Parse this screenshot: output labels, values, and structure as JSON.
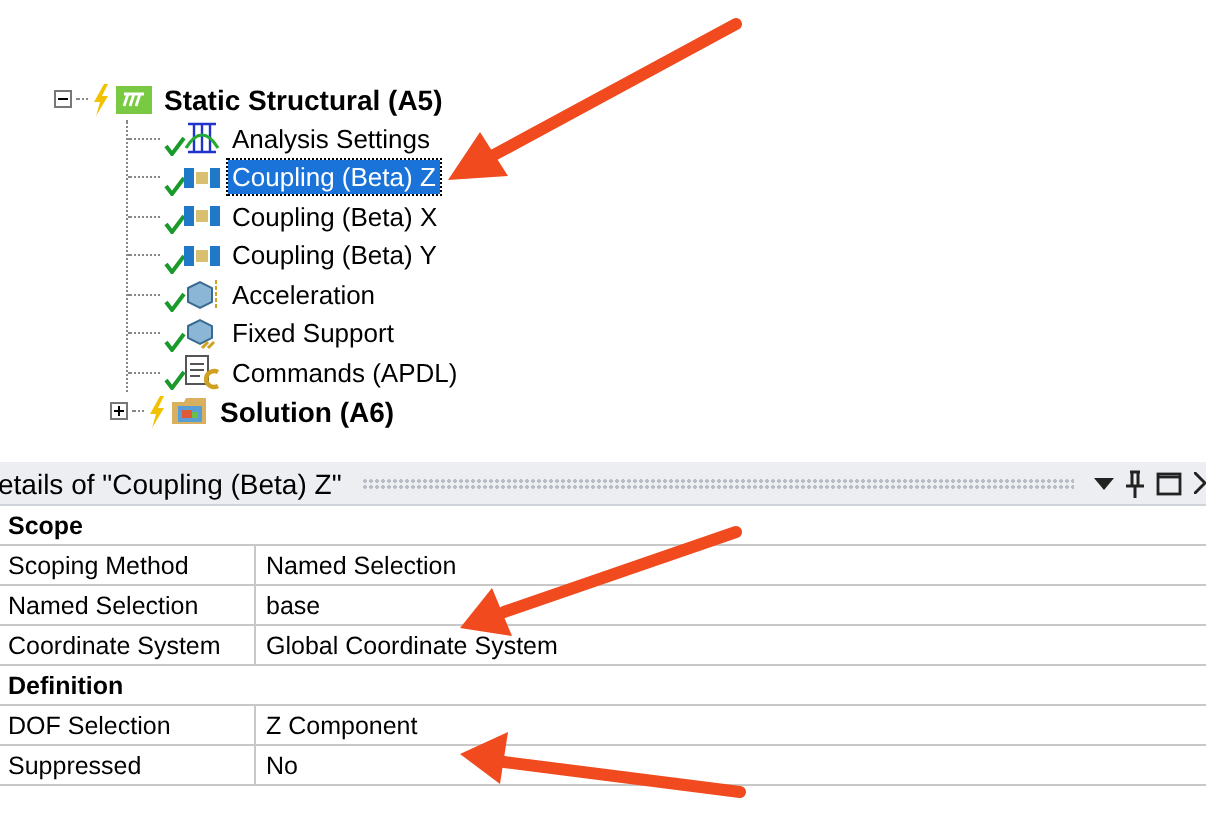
{
  "tree": [
    {
      "label": "Static Structural (A5)",
      "kind": "analysis",
      "expanded": true,
      "selected": false,
      "children": [
        {
          "label": "Analysis Settings",
          "kind": "settings",
          "selected": false
        },
        {
          "label": "Coupling (Beta) Z",
          "kind": "coupling",
          "selected": true
        },
        {
          "label": "Coupling (Beta) X",
          "kind": "coupling",
          "selected": false
        },
        {
          "label": "Coupling (Beta) Y",
          "kind": "coupling",
          "selected": false
        },
        {
          "label": "Acceleration",
          "kind": "acceleration",
          "selected": false
        },
        {
          "label": "Fixed Support",
          "kind": "support",
          "selected": false
        },
        {
          "label": "Commands (APDL)",
          "kind": "commands",
          "selected": false
        }
      ]
    },
    {
      "label": "Solution (A6)",
      "kind": "solution",
      "expanded": false,
      "selected": false
    }
  ],
  "details": {
    "title": "etails of \"Coupling (Beta) Z\"",
    "sections": [
      {
        "title": "Scope",
        "rows": [
          {
            "label": "Scoping Method",
            "value": "Named Selection"
          },
          {
            "label": "Named Selection",
            "value": "base"
          },
          {
            "label": "Coordinate System",
            "value": "Global Coordinate System"
          }
        ]
      },
      {
        "title": "Definition",
        "rows": [
          {
            "label": "DOF Selection",
            "value": "Z Component"
          },
          {
            "label": "Suppressed",
            "value": "No"
          }
        ]
      }
    ]
  }
}
